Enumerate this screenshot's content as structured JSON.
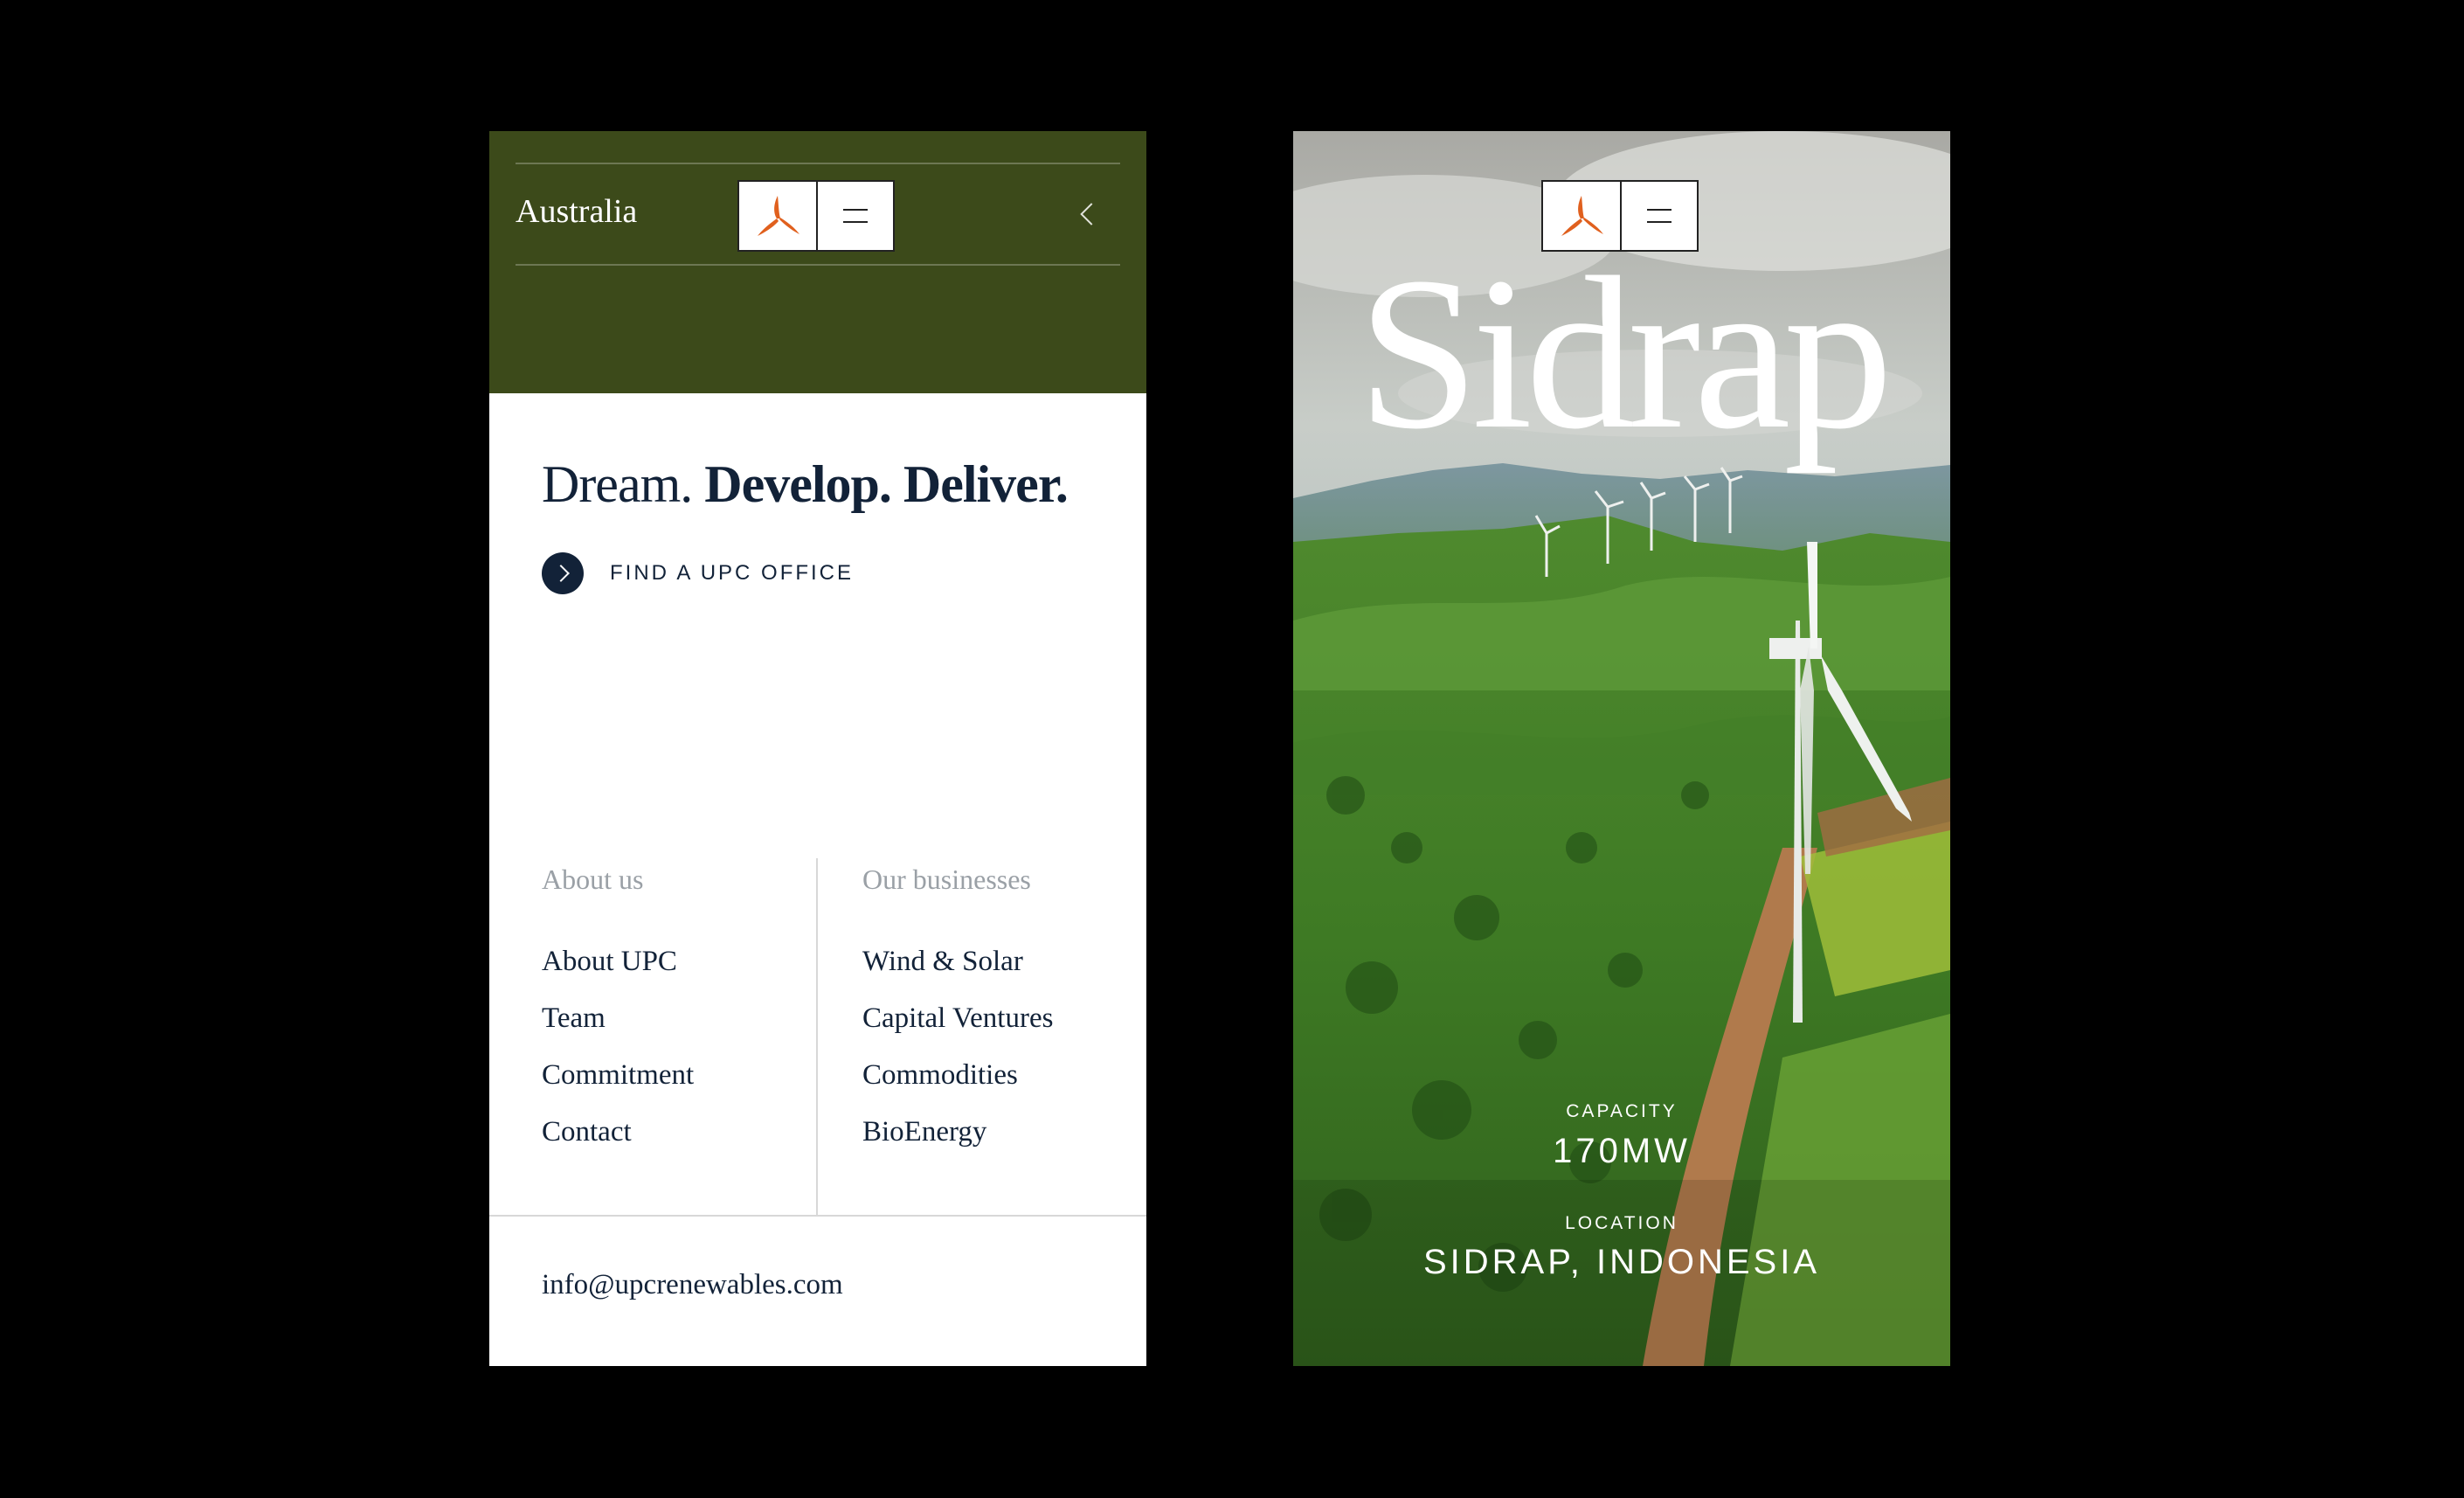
{
  "left_screen": {
    "header": {
      "region": "Australia",
      "logo_icon": "upc-logo-icon",
      "menu_icon": "hamburger-icon",
      "back_icon": "chevron-left-icon",
      "bg_color": "#3c4a1a"
    },
    "tagline": {
      "part1": "Dream.",
      "part2": "Develop. Deliver."
    },
    "find_office": {
      "label": "FIND A UPC OFFICE",
      "icon": "chevron-right-icon"
    },
    "menu": {
      "about": {
        "heading": "About us",
        "items": [
          "About UPC",
          "Team",
          "Commitment",
          "Contact"
        ]
      },
      "businesses": {
        "heading": "Our businesses",
        "items": [
          "Wind & Solar",
          "Capital Ventures",
          "Commodities",
          "BioEnergy"
        ]
      }
    },
    "email": "info@upcrenewables.com"
  },
  "right_screen": {
    "logo_icon": "upc-logo-icon",
    "menu_icon": "hamburger-icon",
    "title": "Sidrap",
    "capacity_label": "CAPACITY",
    "capacity_value": "170MW",
    "location_label": "LOCATION",
    "location_value": "SIDRAP, INDONESIA"
  },
  "colors": {
    "brand_green": "#3c4a1a",
    "navy": "#122238",
    "logo_orange": "#e0601e",
    "muted_gray": "#9aa0a6"
  }
}
